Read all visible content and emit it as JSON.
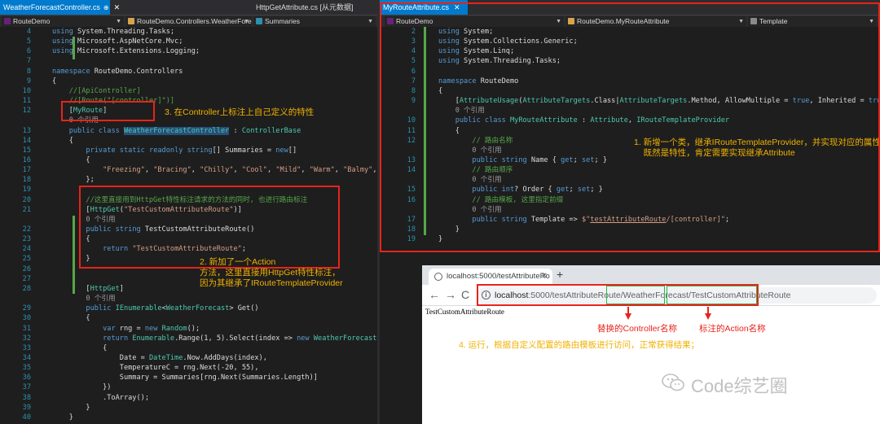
{
  "left_editor": {
    "tabs": [
      {
        "label": "WeatherForecastController.cs",
        "close": "✕",
        "pin": "⊕",
        "active": true
      },
      {
        "label": "HttpGetAttribute.cs [从元数据]",
        "active": false
      }
    ],
    "nav": {
      "project": "RouteDemo",
      "class": "RouteDemo.Controllers.WeatherForec",
      "member": "Summaries"
    },
    "lines": [
      {
        "n": "4",
        "html": "<span class=\"kw\">using</span> System.Threading.Tasks;"
      },
      {
        "n": "5",
        "html": "<span class=\"kw\">using</span> Microsoft.AspNetCore.Mvc;"
      },
      {
        "n": "6",
        "html": "<span class=\"kw\">using</span> Microsoft.Extensions.Logging;"
      },
      {
        "n": "7",
        "html": ""
      },
      {
        "n": "8",
        "html": "<span class=\"kw\">namespace</span> RouteDemo.Controllers"
      },
      {
        "n": "9",
        "html": "{"
      },
      {
        "n": "10",
        "html": "    <span class=\"cm\">//[ApiController]</span>"
      },
      {
        "n": "11",
        "html": "    <span class=\"cm\">//[Route(\"[controller]\")]</span>"
      },
      {
        "n": "12",
        "html": "    [<span class=\"ty\">MyRoute</span>]"
      },
      {
        "n": "",
        "html": "    <span class=\"ref\">0 个引用</span>"
      },
      {
        "n": "13",
        "html": "    <span class=\"kw\">public class</span> <span class=\"ty\" style=\"background:#264f78\">WeatherForecastController</span> : <span class=\"ty\">ControllerBase</span>"
      },
      {
        "n": "14",
        "html": "    {"
      },
      {
        "n": "15",
        "html": "        <span class=\"kw\">private static readonly string</span>[] Summaries = <span class=\"kw\">new</span>[]"
      },
      {
        "n": "16",
        "html": "        {"
      },
      {
        "n": "17",
        "html": "            <span class=\"st\">\"Freezing\"</span>, <span class=\"st\">\"Bracing\"</span>, <span class=\"st\">\"Chilly\"</span>, <span class=\"st\">\"Cool\"</span>, <span class=\"st\">\"Mild\"</span>, <span class=\"st\">\"Warm\"</span>, <span class=\"st\">\"Balmy\"</span>,"
      },
      {
        "n": "18",
        "html": "        };"
      },
      {
        "n": "19",
        "html": ""
      },
      {
        "n": "20",
        "html": "        <span class=\"cm\">//这里直接用到HttpGet特性标注请求的方法的同时, 也进行路由标注</span>"
      },
      {
        "n": "21",
        "html": "        [<span class=\"ty\">HttpGet</span>(<span class=\"st\">\"TestCustomAttributeRoute\"</span>)]"
      },
      {
        "n": "",
        "html": "        <span class=\"ref\">0 个引用</span>"
      },
      {
        "n": "22",
        "html": "        <span class=\"kw\">public string</span> TestCustomAttributeRoute()"
      },
      {
        "n": "23",
        "html": "        {"
      },
      {
        "n": "24",
        "html": "            <span class=\"kw\">return</span> <span class=\"st\">\"TestCustomAttributeRoute\"</span>;"
      },
      {
        "n": "25",
        "html": "        }"
      },
      {
        "n": "26",
        "html": ""
      },
      {
        "n": "27",
        "html": ""
      },
      {
        "n": "28",
        "html": "        [<span class=\"ty\">HttpGet</span>]"
      },
      {
        "n": "",
        "html": "        <span class=\"ref\">0 个引用</span>"
      },
      {
        "n": "29",
        "html": "        <span class=\"kw\">public</span> <span class=\"ty\">IEnumerable</span>&lt;<span class=\"ty\">WeatherForecast</span>&gt; Get()"
      },
      {
        "n": "30",
        "html": "        {"
      },
      {
        "n": "31",
        "html": "            <span class=\"kw\">var</span> rng = <span class=\"kw\">new</span> <span class=\"ty\">Random</span>();"
      },
      {
        "n": "32",
        "html": "            <span class=\"kw\">return</span> <span class=\"ty\">Enumerable</span>.Range(1, 5).Select(index =&gt; <span class=\"kw\">new</span> <span class=\"ty\">WeatherForecast</span>"
      },
      {
        "n": "33",
        "html": "            {"
      },
      {
        "n": "34",
        "html": "                Date = <span class=\"ty\">DateTime</span>.Now.AddDays(index),"
      },
      {
        "n": "35",
        "html": "                TemperatureC = rng.Next(-20, 55),"
      },
      {
        "n": "36",
        "html": "                Summary = Summaries[rng.Next(Summaries.Length)]"
      },
      {
        "n": "37",
        "html": "            })"
      },
      {
        "n": "38",
        "html": "            .ToArray();"
      },
      {
        "n": "39",
        "html": "        }"
      },
      {
        "n": "40",
        "html": "    }"
      }
    ]
  },
  "right_editor": {
    "tabs": [
      {
        "label": "MyRouteAttribute.cs",
        "close": "✕",
        "active": true
      }
    ],
    "nav": {
      "project": "RouteDemo",
      "class": "RouteDemo.MyRouteAttribute",
      "member": "Template"
    },
    "lines": [
      {
        "n": "2",
        "html": "<span class=\"kw\">using</span> System;"
      },
      {
        "n": "3",
        "html": "<span class=\"kw\">using</span> System.Collections.Generic;"
      },
      {
        "n": "4",
        "html": "<span class=\"kw\">using</span> System.Linq;"
      },
      {
        "n": "5",
        "html": "<span class=\"kw\">using</span> System.Threading.Tasks;"
      },
      {
        "n": "6",
        "html": ""
      },
      {
        "n": "7",
        "html": "<span class=\"kw\">namespace</span> RouteDemo"
      },
      {
        "n": "8",
        "html": "{"
      },
      {
        "n": "9",
        "html": "    [<span class=\"ty\">AttributeUsage</span>(<span class=\"ty\">AttributeTargets</span>.Class|<span class=\"ty\">AttributeTargets</span>.Method, AllowMultiple = <span class=\"kw\">true</span>, Inherited = <span class=\"kw\">true</span>)]"
      },
      {
        "n": "",
        "html": "    <span class=\"ref\">0 个引用</span>"
      },
      {
        "n": "10",
        "html": "    <span class=\"kw\">public class</span> <span class=\"ty\">MyRouteAttribute</span> : <span class=\"ty\">Attribute</span>, <span class=\"ty\">IRouteTemplateProvider</span>"
      },
      {
        "n": "11",
        "html": "    {"
      },
      {
        "n": "12",
        "html": "        <span class=\"cm\">// 路由名称</span>"
      },
      {
        "n": "",
        "html": "        <span class=\"ref\">0 个引用</span>"
      },
      {
        "n": "13",
        "html": "        <span class=\"kw\">public string</span> Name { <span class=\"kw\">get</span>; <span class=\"kw\">set</span>; }"
      },
      {
        "n": "14",
        "html": "        <span class=\"cm\">// 路由顺序</span>"
      },
      {
        "n": "",
        "html": "        <span class=\"ref\">0 个引用</span>"
      },
      {
        "n": "15",
        "html": "        <span class=\"kw\">public int</span>? Order { <span class=\"kw\">get</span>; <span class=\"kw\">set</span>; }"
      },
      {
        "n": "16",
        "html": "        <span class=\"cm\">// 路由模板, 这里指定前缀</span>"
      },
      {
        "n": "",
        "html": "        <span class=\"ref\">0 个引用</span>"
      },
      {
        "n": "17",
        "html": "        <span class=\"kw\">public string</span> Template =&gt; <span class=\"st\">$\"</span><span class=\"st\" style=\"text-decoration:underline\">testAttributeRoute</span><span class=\"st\">/[controller]\"</span>;"
      },
      {
        "n": "18",
        "html": "    }"
      },
      {
        "n": "19",
        "html": "}"
      }
    ]
  },
  "annotations": {
    "step3": "3. 在Controller上标注上自己定义的特性",
    "step2": "2. 新加了一个Action\n方法，这里直接用HttpGet特性标注，\n因为其继承了IRouteTemplateProvider",
    "step1": "1. 新增一个类，继承IRouteTemplateProvider，并实现对应的属性；\n    既然是特性，肯定需要实现继承Attribute",
    "step4": "4. 运行，根据自定义配置的路由模板进行访问，正常获得结果；",
    "replaced_controller": "替换的Controller名称",
    "marked_action": "标注的Action名称"
  },
  "browser": {
    "tab_title": "localhost:5000/testAttributeRo",
    "tab_close": "✕",
    "new_tab": "+",
    "back": "←",
    "forward": "→",
    "reload": "C",
    "info": "i",
    "url_host": "localhost",
    "url_path_a": ":5000/testAttributeRoute/",
    "url_controller": "WeatherForecast",
    "url_sep": "/",
    "url_action": "TestCustomAttributeRoute",
    "body_text": "TestCustomAttributeRoute"
  },
  "watermark": "Code综艺圈",
  "colors": {
    "editor_bg": "#1e1e1e",
    "accent_blue": "#007acc",
    "annotation_red": "#e8231a",
    "annotation_yellow": "#f0b100",
    "highlight_green": "#2db34a"
  }
}
